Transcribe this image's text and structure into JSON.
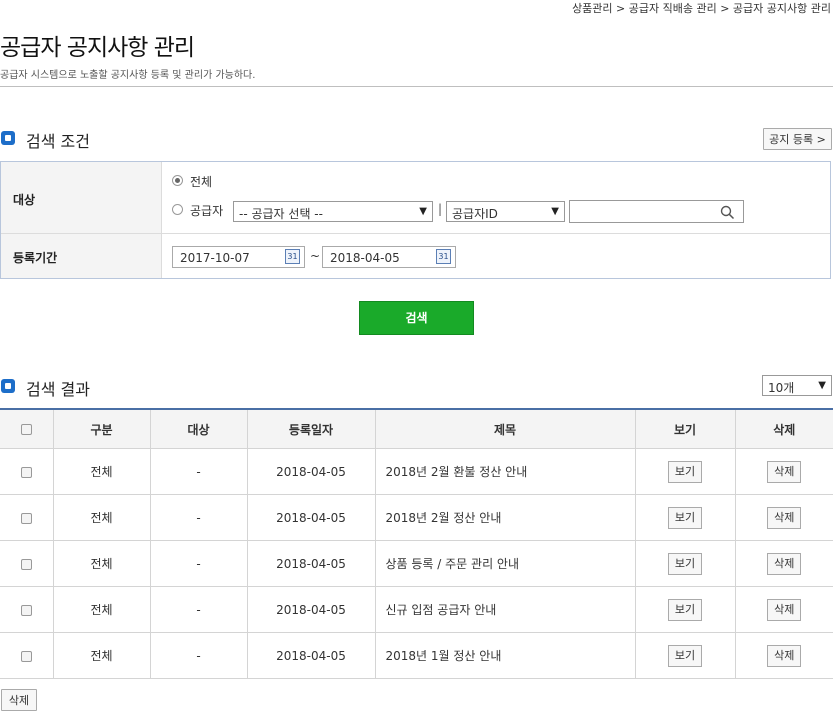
{
  "breadcrumb": "상품관리 > 공급자 직배송 관리 > 공급자 공지사항 관리",
  "page": {
    "title": "공급자 공지사항 관리",
    "description": "공급자 시스템으로 노출할 공지사항 등록 및 관리가 가능하다."
  },
  "search_section": {
    "title": "검색 조건",
    "register_button": "공지 등록 >",
    "target_label": "대상",
    "radio_all": "전체",
    "radio_supplier": "공급자",
    "supplier_select": "-- 공급자 선택 --",
    "separator": "|",
    "id_select": "공급자ID",
    "search_input_value": "",
    "period_label": "등록기간",
    "date_from": "2017-10-07",
    "date_tilde": "~",
    "date_to": "2018-04-05",
    "calendar_icon_text": "31",
    "search_button": "검색"
  },
  "results_section": {
    "title": "검색 결과",
    "page_size": "10개",
    "columns": [
      "구분",
      "대상",
      "등록일자",
      "제목",
      "보기",
      "삭제"
    ],
    "rows": [
      {
        "category": "전체",
        "target": "-",
        "date": "2018-04-05",
        "title": "2018년 2월 환불 정산 안내",
        "view": "보기",
        "delete": "삭제"
      },
      {
        "category": "전체",
        "target": "-",
        "date": "2018-04-05",
        "title": "2018년 2월 정산 안내",
        "view": "보기",
        "delete": "삭제"
      },
      {
        "category": "전체",
        "target": "-",
        "date": "2018-04-05",
        "title": "상품 등록 / 주문 관리 안내",
        "view": "보기",
        "delete": "삭제"
      },
      {
        "category": "전체",
        "target": "-",
        "date": "2018-04-05",
        "title": "신규 입점 공급자 안내",
        "view": "보기",
        "delete": "삭제"
      },
      {
        "category": "전체",
        "target": "-",
        "date": "2018-04-05",
        "title": "2018년 1월 정산 안내",
        "view": "보기",
        "delete": "삭제"
      }
    ],
    "bulk_delete_button": "삭제"
  },
  "colors": {
    "accent_blue": "#1d6ec9",
    "search_green": "#1aaa2a",
    "header_border": "#4a6fa5"
  }
}
